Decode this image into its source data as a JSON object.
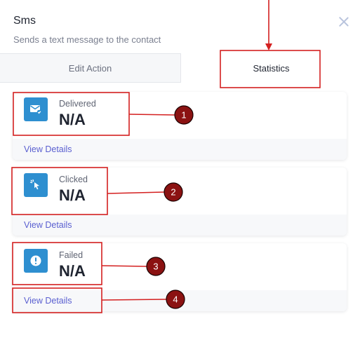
{
  "panel": {
    "title": "Sms",
    "subtitle": "Sends a text message to the contact"
  },
  "tabs": [
    {
      "label": "Edit Action",
      "active": false
    },
    {
      "label": "Statistics",
      "active": true
    }
  ],
  "cards": [
    {
      "icon": "envelope-check-icon",
      "label": "Delivered",
      "value": "N/A",
      "link": "View Details"
    },
    {
      "icon": "cursor-click-icon",
      "label": "Clicked",
      "value": "N/A",
      "link": "View Details"
    },
    {
      "icon": "exclamation-circle-icon",
      "label": "Failed",
      "value": "N/A",
      "link": "View Details"
    }
  ],
  "annotations": {
    "badges": [
      "1",
      "2",
      "3",
      "4"
    ],
    "highlight_color": "#d42020",
    "badge_color": "#8b1212"
  },
  "colors": {
    "icon_bg": "#2e8fd0",
    "link": "#5a5fd0"
  }
}
